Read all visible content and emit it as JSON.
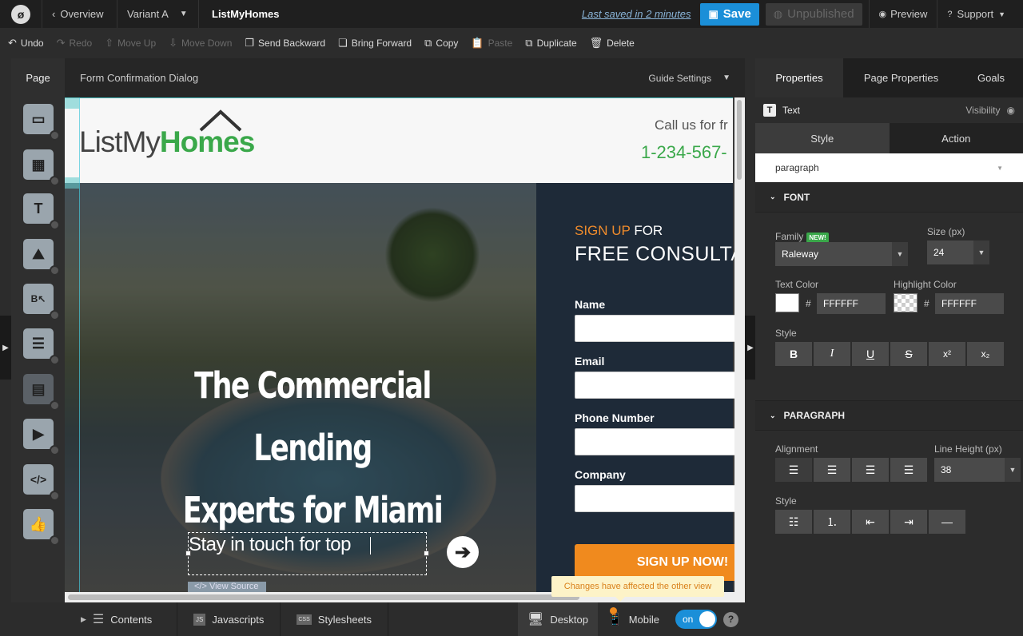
{
  "topbar": {
    "logo": "ø",
    "overview": "Overview",
    "variant": "Variant A",
    "page_name": "ListMyHomes",
    "last_saved": "Last saved  in 2 minutes",
    "save": "Save",
    "unpublished": "Unpublished",
    "preview": "Preview",
    "support": "Support"
  },
  "toolbar": {
    "undo": "Undo",
    "redo": "Redo",
    "move_up": "Move Up",
    "move_down": "Move Down",
    "send_backward": "Send Backward",
    "bring_forward": "Bring Forward",
    "copy": "Copy",
    "paste": "Paste",
    "duplicate": "Duplicate",
    "delete": "Delete"
  },
  "editor": {
    "page_tab": "Page",
    "form_title": "Form Confirmation Dialog",
    "guide_settings": "Guide Settings"
  },
  "canvas": {
    "logo_plain": "ListMy",
    "logo_green": "Homes",
    "call_us": "Call us for fr",
    "phone": "1-234-567-",
    "hero_line1": "The Commercial Lending",
    "hero_line2": "Experts for Miami",
    "signup_orange": "SIGN UP",
    "signup_white": " FOR",
    "free_consult": "FREE CONSULTA",
    "labels": [
      "Name",
      "Email",
      "Phone Number",
      "Company"
    ],
    "signup_button": "SIGN UP NOW!",
    "stay_text": "Stay in touch for top",
    "view_source": "</> View Source",
    "toast": "Changes have affected the other view"
  },
  "bottombar": {
    "contents": "Contents",
    "javascripts": "Javascripts",
    "stylesheets": "Stylesheets",
    "desktop": "Desktop",
    "mobile": "Mobile",
    "toggle": "on",
    "help": "?"
  },
  "panel": {
    "tabs": [
      "Properties",
      "Page Properties",
      "Goals"
    ],
    "element_type": "Text",
    "visibility": "Visibility",
    "subtabs": [
      "Style",
      "Action"
    ],
    "paragraph_select": "paragraph",
    "font_section": "FONT",
    "family_label": "Family",
    "new_badge": "NEW!",
    "family_value": "Raleway",
    "size_label": "Size (px)",
    "size_value": "24",
    "text_color_label": "Text Color",
    "text_color_hex": "FFFFFF",
    "highlight_label": "Highlight Color",
    "highlight_hex": "FFFFFF",
    "style_label": "Style",
    "style_buttons": [
      "B",
      "I",
      "U",
      "S",
      "x²",
      "x₂"
    ],
    "paragraph_section": "PARAGRAPH",
    "alignment_label": "Alignment",
    "line_height_label": "Line Height (px)",
    "line_height_value": "38",
    "para_style_label": "Style"
  },
  "colors": {
    "accent_blue": "#1b8fd8",
    "brand_green": "#3aa84a",
    "signup_orange": "#f08a1e"
  }
}
